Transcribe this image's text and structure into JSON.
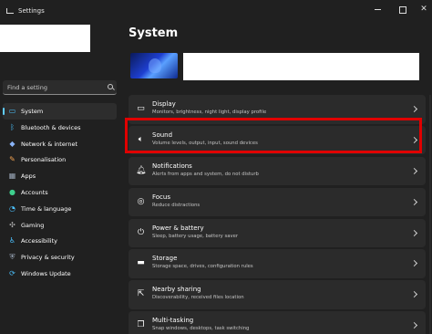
{
  "window": {
    "title": "Settings",
    "minimize": "",
    "maximize": "",
    "close": "✕"
  },
  "sidebar": {
    "search_placeholder": "Find a setting",
    "items": [
      {
        "label": "System",
        "icon": "monitor-icon",
        "active": true
      },
      {
        "label": "Bluetooth & devices",
        "icon": "bluetooth-icon"
      },
      {
        "label": "Network & internet",
        "icon": "network-icon"
      },
      {
        "label": "Personalisation",
        "icon": "brush-icon"
      },
      {
        "label": "Apps",
        "icon": "apps-icon"
      },
      {
        "label": "Accounts",
        "icon": "person-icon"
      },
      {
        "label": "Time & language",
        "icon": "globe-clock-icon"
      },
      {
        "label": "Gaming",
        "icon": "gamepad-icon"
      },
      {
        "label": "Accessibility",
        "icon": "accessibility-icon"
      },
      {
        "label": "Privacy & security",
        "icon": "shield-icon"
      },
      {
        "label": "Windows Update",
        "icon": "update-icon"
      }
    ]
  },
  "main": {
    "title": "System",
    "cards": [
      {
        "title": "Display",
        "subtitle": "Monitors, brightness, night light, display profile",
        "icon": "display-icon"
      },
      {
        "title": "Sound",
        "subtitle": "Volume levels, output, input, sound devices",
        "icon": "speaker-icon"
      },
      {
        "title": "Notifications",
        "subtitle": "Alerts from apps and system, do not disturb",
        "icon": "bell-icon"
      },
      {
        "title": "Focus",
        "subtitle": "Reduce distractions",
        "icon": "focus-icon"
      },
      {
        "title": "Power & battery",
        "subtitle": "Sleep, battery usage, battery saver",
        "icon": "power-icon"
      },
      {
        "title": "Storage",
        "subtitle": "Storage space, drives, configuration rules",
        "icon": "storage-icon"
      },
      {
        "title": "Nearby sharing",
        "subtitle": "Discoverability, received files location",
        "icon": "share-icon"
      },
      {
        "title": "Multi-tasking",
        "subtitle": "Snap windows, desktops, task switching",
        "icon": "multitask-icon"
      }
    ]
  },
  "colors": {
    "background": "#202020",
    "card": "#2b2b2b",
    "accent": "#60cdff",
    "highlight": "#e00000"
  }
}
